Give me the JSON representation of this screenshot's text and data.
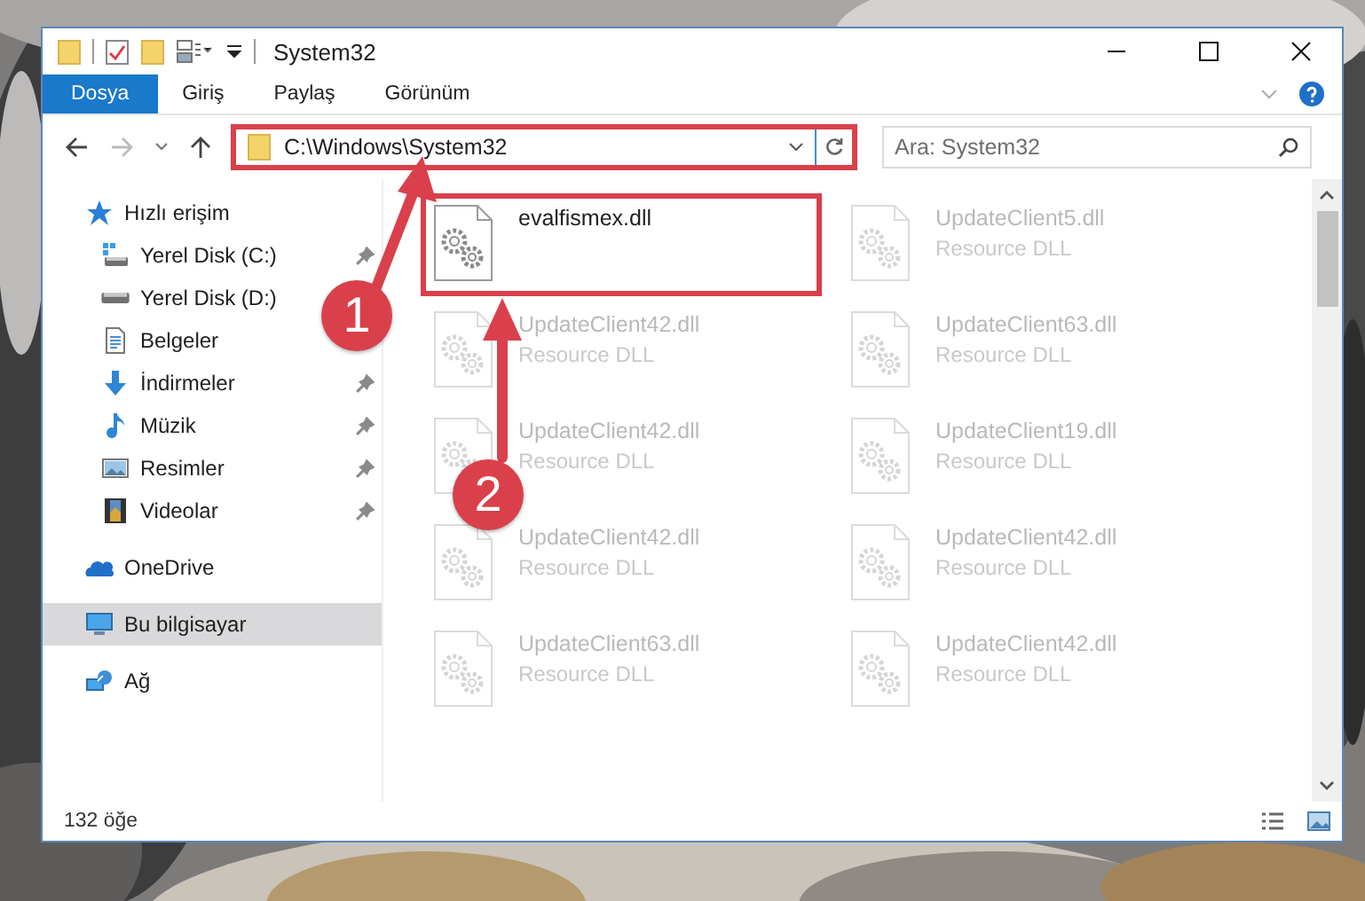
{
  "window": {
    "title": "System32"
  },
  "ribbon": {
    "tabs": [
      {
        "label": "Dosya",
        "selected": true
      },
      {
        "label": "Giriş",
        "selected": false
      },
      {
        "label": "Paylaş",
        "selected": false
      },
      {
        "label": "Görünüm",
        "selected": false
      }
    ]
  },
  "address_bar": {
    "path": "C:\\Windows\\System32",
    "highlighted": true
  },
  "search": {
    "placeholder": "Ara: System32"
  },
  "nav": [
    {
      "label": "Hızlı erişim",
      "kind": "star",
      "selected": false,
      "children": [
        {
          "label": "Yerel Disk (C:)",
          "kind": "drive-win",
          "pinned": true,
          "selected": false
        },
        {
          "label": "Yerel Disk (D:)",
          "kind": "drive",
          "selected": false
        },
        {
          "label": "Belgeler",
          "kind": "docs",
          "selected": false
        },
        {
          "label": "İndirmeler",
          "kind": "download",
          "pinned": true,
          "selected": false
        },
        {
          "label": "Müzik",
          "kind": "music",
          "pinned": true,
          "selected": false
        },
        {
          "label": "Resimler",
          "kind": "pictures",
          "pinned": true,
          "selected": false
        },
        {
          "label": "Videolar",
          "kind": "video",
          "pinned": true,
          "selected": false
        }
      ]
    },
    {
      "label": "OneDrive",
      "kind": "cloud",
      "selected": false
    },
    {
      "label": "Bu bilgisayar",
      "kind": "pc",
      "selected": true
    },
    {
      "label": "Ağ",
      "kind": "network",
      "selected": false
    }
  ],
  "files": [
    {
      "name": "evalfismex.dll",
      "highlighted": true,
      "faded": false
    },
    {
      "name": "UpdateClient5.dll",
      "type": "Resource DLL",
      "highlighted": false,
      "faded": true
    },
    {
      "name": "UpdateClient42.dll",
      "type": "Resource DLL",
      "highlighted": false,
      "faded": true
    },
    {
      "name": "UpdateClient63.dll",
      "type": "Resource DLL",
      "highlighted": false,
      "faded": true
    },
    {
      "name": "UpdateClient42.dll",
      "type": "Resource DLL",
      "highlighted": false,
      "faded": true
    },
    {
      "name": "UpdateClient19.dll",
      "type": "Resource DLL",
      "highlighted": false,
      "faded": true
    },
    {
      "name": "UpdateClient42.dll",
      "type": "Resource DLL",
      "highlighted": false,
      "faded": true
    },
    {
      "name": "UpdateClient42.dll",
      "type": "Resource DLL",
      "highlighted": false,
      "faded": true
    },
    {
      "name": "UpdateClient63.dll",
      "type": "Resource DLL",
      "highlighted": false,
      "faded": true
    },
    {
      "name": "UpdateClient42.dll",
      "type": "Resource DLL",
      "highlighted": false,
      "faded": true
    }
  ],
  "status_bar": {
    "count": "132 öğe"
  },
  "annotations": {
    "badges": [
      "1",
      "2"
    ]
  }
}
